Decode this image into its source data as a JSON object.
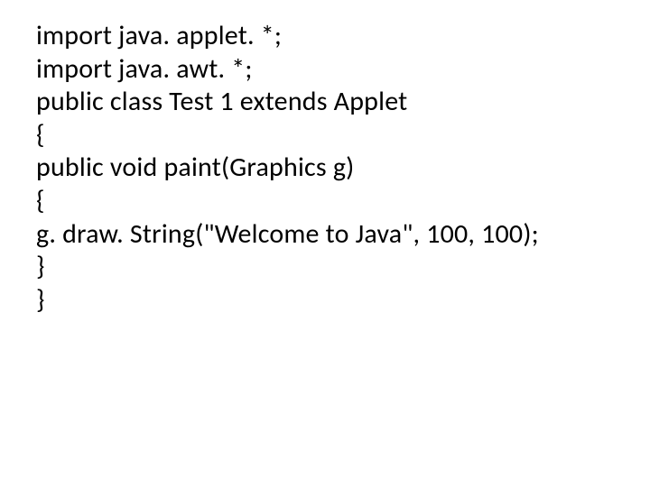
{
  "code": {
    "line0": "import java. applet. *;",
    "line1": "import java. awt. *;",
    "line2": "public class Test 1 extends Applet",
    "line3": "{",
    "line4": "public void paint(Graphics g)",
    "line5": "{",
    "line6": "g. draw. String(\"Welcome to Java\", 100, 100);",
    "line7": "}",
    "line8": "}"
  }
}
